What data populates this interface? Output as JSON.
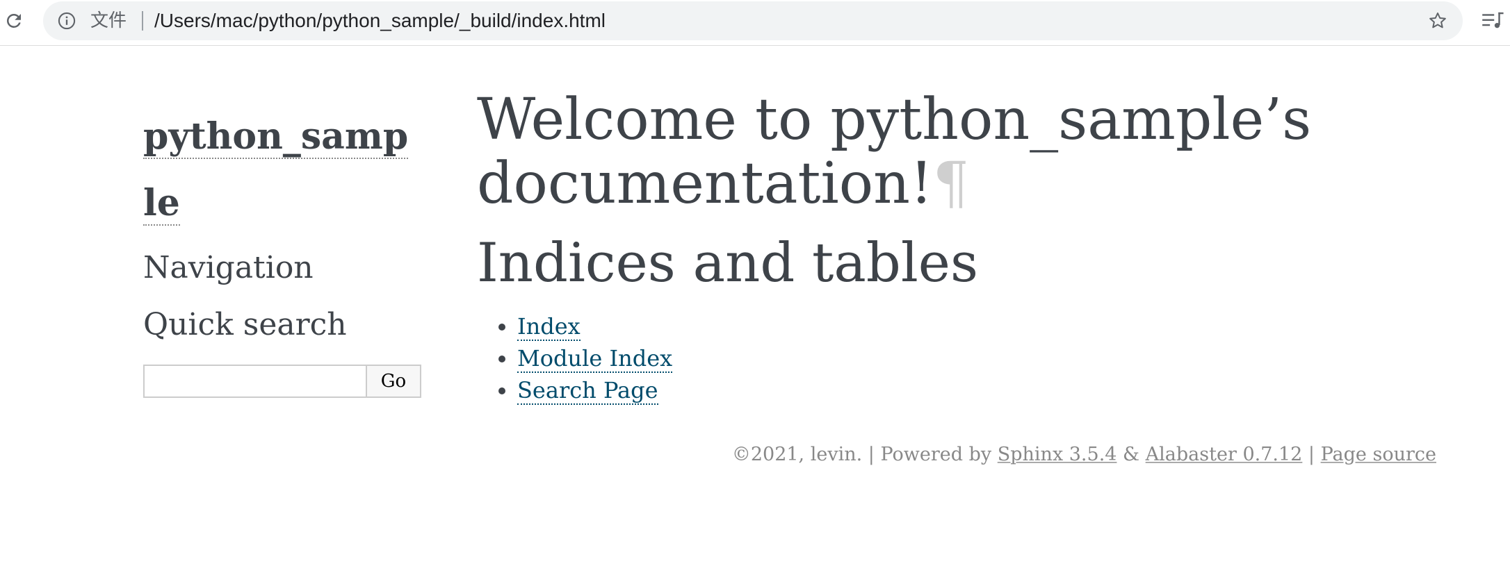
{
  "browser": {
    "file_label": "文件",
    "url": "/Users/mac/python/python_sample/_build/index.html",
    "icons": {
      "reload": "reload-icon",
      "info": "info-icon",
      "star": "star-icon",
      "reading_list": "reading-list-icon"
    }
  },
  "sidebar": {
    "project_name": "python_sample",
    "navigation_heading": "Navigation",
    "search_heading": "Quick search",
    "search_input_value": "",
    "search_button_label": "Go"
  },
  "main": {
    "title": "Welcome to python_sample’s documentation!",
    "pilcrow": "¶",
    "section_title": "Indices and tables",
    "links": [
      {
        "label": "Index"
      },
      {
        "label": "Module Index"
      },
      {
        "label": "Search Page"
      }
    ]
  },
  "footer": {
    "copyright": "©2021, levin. | Powered by ",
    "sphinx_link": "Sphinx 3.5.4",
    "amp": " & ",
    "alabaster_link": "Alabaster 0.7.12",
    "separator": " | ",
    "page_source_link": "Page source"
  },
  "colors": {
    "text": "#3e4349",
    "link": "#004b6b",
    "footer_text": "#888888",
    "omnibox_bg": "#f1f3f4"
  }
}
